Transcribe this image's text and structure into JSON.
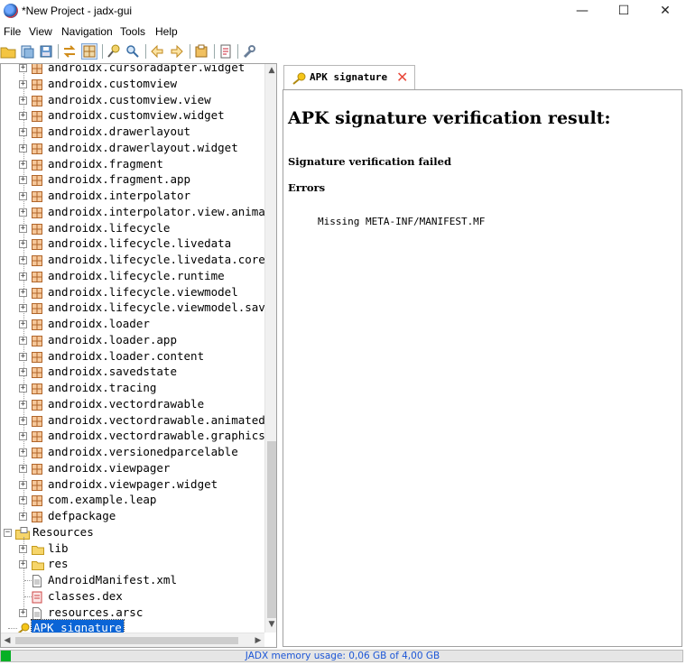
{
  "window": {
    "title": "*New Project - jadx-gui",
    "controls": {
      "minimize": "—",
      "maximize": "☐",
      "close": "✕"
    }
  },
  "menu": [
    "File",
    "View",
    "Navigation",
    "Tools",
    "Help"
  ],
  "toolbar": {
    "icons": [
      "open-folder-icon",
      "add-files-icon",
      "save-all-icon",
      "sync-tree-icon",
      "flatten-packages-icon",
      "search-text-icon",
      "find-class-icon",
      "back-icon",
      "forward-icon",
      "decompile-icon",
      "log-icon",
      "preferences-icon"
    ]
  },
  "tree": {
    "packages": [
      "androidx.cursoradapter.widget",
      "androidx.customview",
      "androidx.customview.view",
      "androidx.customview.widget",
      "androidx.drawerlayout",
      "androidx.drawerlayout.widget",
      "androidx.fragment",
      "androidx.fragment.app",
      "androidx.interpolator",
      "androidx.interpolator.view.anima",
      "androidx.lifecycle",
      "androidx.lifecycle.livedata",
      "androidx.lifecycle.livedata.core",
      "androidx.lifecycle.runtime",
      "androidx.lifecycle.viewmodel",
      "androidx.lifecycle.viewmodel.sav",
      "androidx.loader",
      "androidx.loader.app",
      "androidx.loader.content",
      "androidx.savedstate",
      "androidx.tracing",
      "androidx.vectordrawable",
      "androidx.vectordrawable.animated",
      "androidx.vectordrawable.graphics",
      "androidx.versionedparcelable",
      "androidx.viewpager",
      "androidx.viewpager.widget",
      "com.example.leap",
      "defpackage"
    ],
    "resources_label": "Resources",
    "resources": [
      {
        "label": "lib",
        "type": "folder",
        "expandable": true
      },
      {
        "label": "res",
        "type": "folder",
        "expandable": true
      },
      {
        "label": "AndroidManifest.xml",
        "type": "file",
        "expandable": false
      },
      {
        "label": "classes.dex",
        "type": "dex",
        "expandable": false
      },
      {
        "label": "resources.arsc",
        "type": "file",
        "expandable": true
      }
    ],
    "apk_signature_label": "APK signature"
  },
  "tab": {
    "label": "APK signature",
    "close": "✕"
  },
  "content": {
    "heading": "APK signature verification result:",
    "status": "Signature verification failed",
    "errors_heading": "Errors",
    "errors": [
      "Missing META-INF/MANIFEST.MF"
    ]
  },
  "status": {
    "memory_text": "JADX memory usage: 0,06 GB of 4,00 GB",
    "memory_fraction": 0.015,
    "memory_color": "#06b025"
  }
}
